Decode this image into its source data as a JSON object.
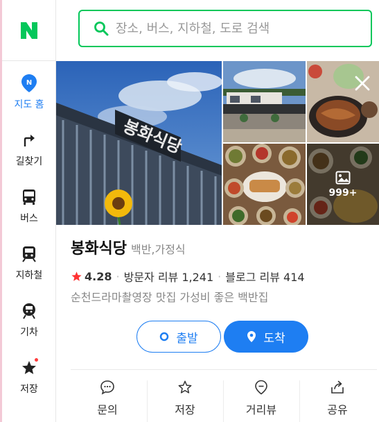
{
  "colors": {
    "brand_green": "#03c75a",
    "accent_blue": "#1e7ef2",
    "star_red": "#f33"
  },
  "logo": {
    "letter": "N"
  },
  "sidebar": {
    "items": [
      {
        "label": "지도 홈",
        "icon": "map-pin-icon",
        "active": true
      },
      {
        "label": "길찾기",
        "icon": "turn-right-arrow-icon"
      },
      {
        "label": "버스",
        "icon": "bus-icon"
      },
      {
        "label": "지하철",
        "icon": "subway-icon"
      },
      {
        "label": "기차",
        "icon": "train-icon"
      },
      {
        "label": "저장",
        "icon": "star-icon",
        "badge": "red-dot"
      }
    ]
  },
  "search": {
    "placeholder": "장소, 버스, 지하철, 도로 검색",
    "icon": "search-icon"
  },
  "photos": {
    "more_count": "999+",
    "more_icon": "image-icon",
    "close_icon": "close-icon"
  },
  "place": {
    "name": "봉화식당",
    "category": "백반,가정식",
    "rating": "4.28",
    "visitor_review": "방문자 리뷰 1,241",
    "blog_review": "블로그 리뷰 414",
    "description": "순천드라마촬영장 맛집 가성비 좋은 백반집"
  },
  "buttons": {
    "start": "출발",
    "arrive": "도착"
  },
  "actions": [
    {
      "label": "문의",
      "icon": "chat-bubble-icon"
    },
    {
      "label": "저장",
      "icon": "star-outline-icon"
    },
    {
      "label": "거리뷰",
      "icon": "street-view-pin-icon"
    },
    {
      "label": "공유",
      "icon": "share-icon"
    }
  ]
}
